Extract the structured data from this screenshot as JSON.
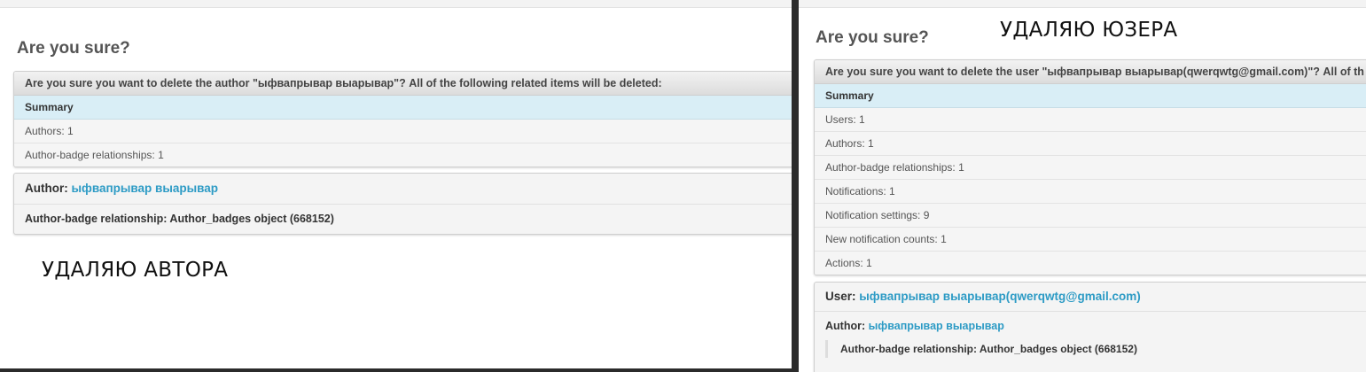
{
  "left": {
    "heading": "Are you sure?",
    "question": "Are you sure you want to delete the author \"ыфвапрывар выарывар\"? All of the following related items will be deleted:",
    "summary_title": "Summary",
    "summary_rows": [
      "Authors: 1",
      "Author-badge relationships: 1"
    ],
    "author_label": "Author:",
    "author_link": "ыфвапрывар выарывар",
    "badge_text": "Author-badge relationship: Author_badges object (668152)",
    "caption": "УДАЛЯЮ АВТОРА"
  },
  "right": {
    "heading": "Are you sure?",
    "caption": "УДАЛЯЮ ЮЗЕРА",
    "question": "Are you sure you want to delete the user \"ыфвапрывар выарывар(qwerqwtg@gmail.com)\"? All of th",
    "summary_title": "Summary",
    "summary_rows": [
      "Users: 1",
      "Authors: 1",
      "Author-badge relationships: 1",
      "Notifications: 1",
      "Notification settings: 9",
      "New notification counts: 1",
      "Actions: 1"
    ],
    "user_label": "User:",
    "user_link": "ыфвапрывар выарывар(qwerqwtg@gmail.com)",
    "author_label": "Author:",
    "author_link": "ыфвапрывар выарывар",
    "badge_text": "Author-badge relationship: Author_badges object (668152)"
  }
}
